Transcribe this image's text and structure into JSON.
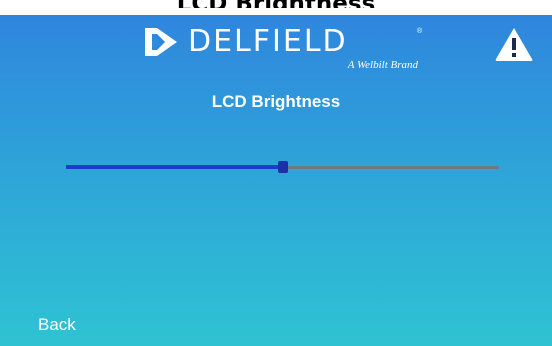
{
  "caption": "LCD Brightness",
  "header": {
    "brand": "DELFIELD",
    "trademark": "®",
    "tagline": "A Welbilt Brand",
    "warning_icon": "warning-triangle-icon",
    "logo_icon": "delfield-logo-mark-icon"
  },
  "screen": {
    "title": "LCD Brightness"
  },
  "brightness_slider": {
    "value_fraction": 0.5
  },
  "footer": {
    "back_label": "Back"
  },
  "colors": {
    "gradient_top": "#2f86de",
    "gradient_bottom": "#2ec3d3",
    "slider_fill": "#1d3ccf",
    "slider_track": "#707a86"
  }
}
